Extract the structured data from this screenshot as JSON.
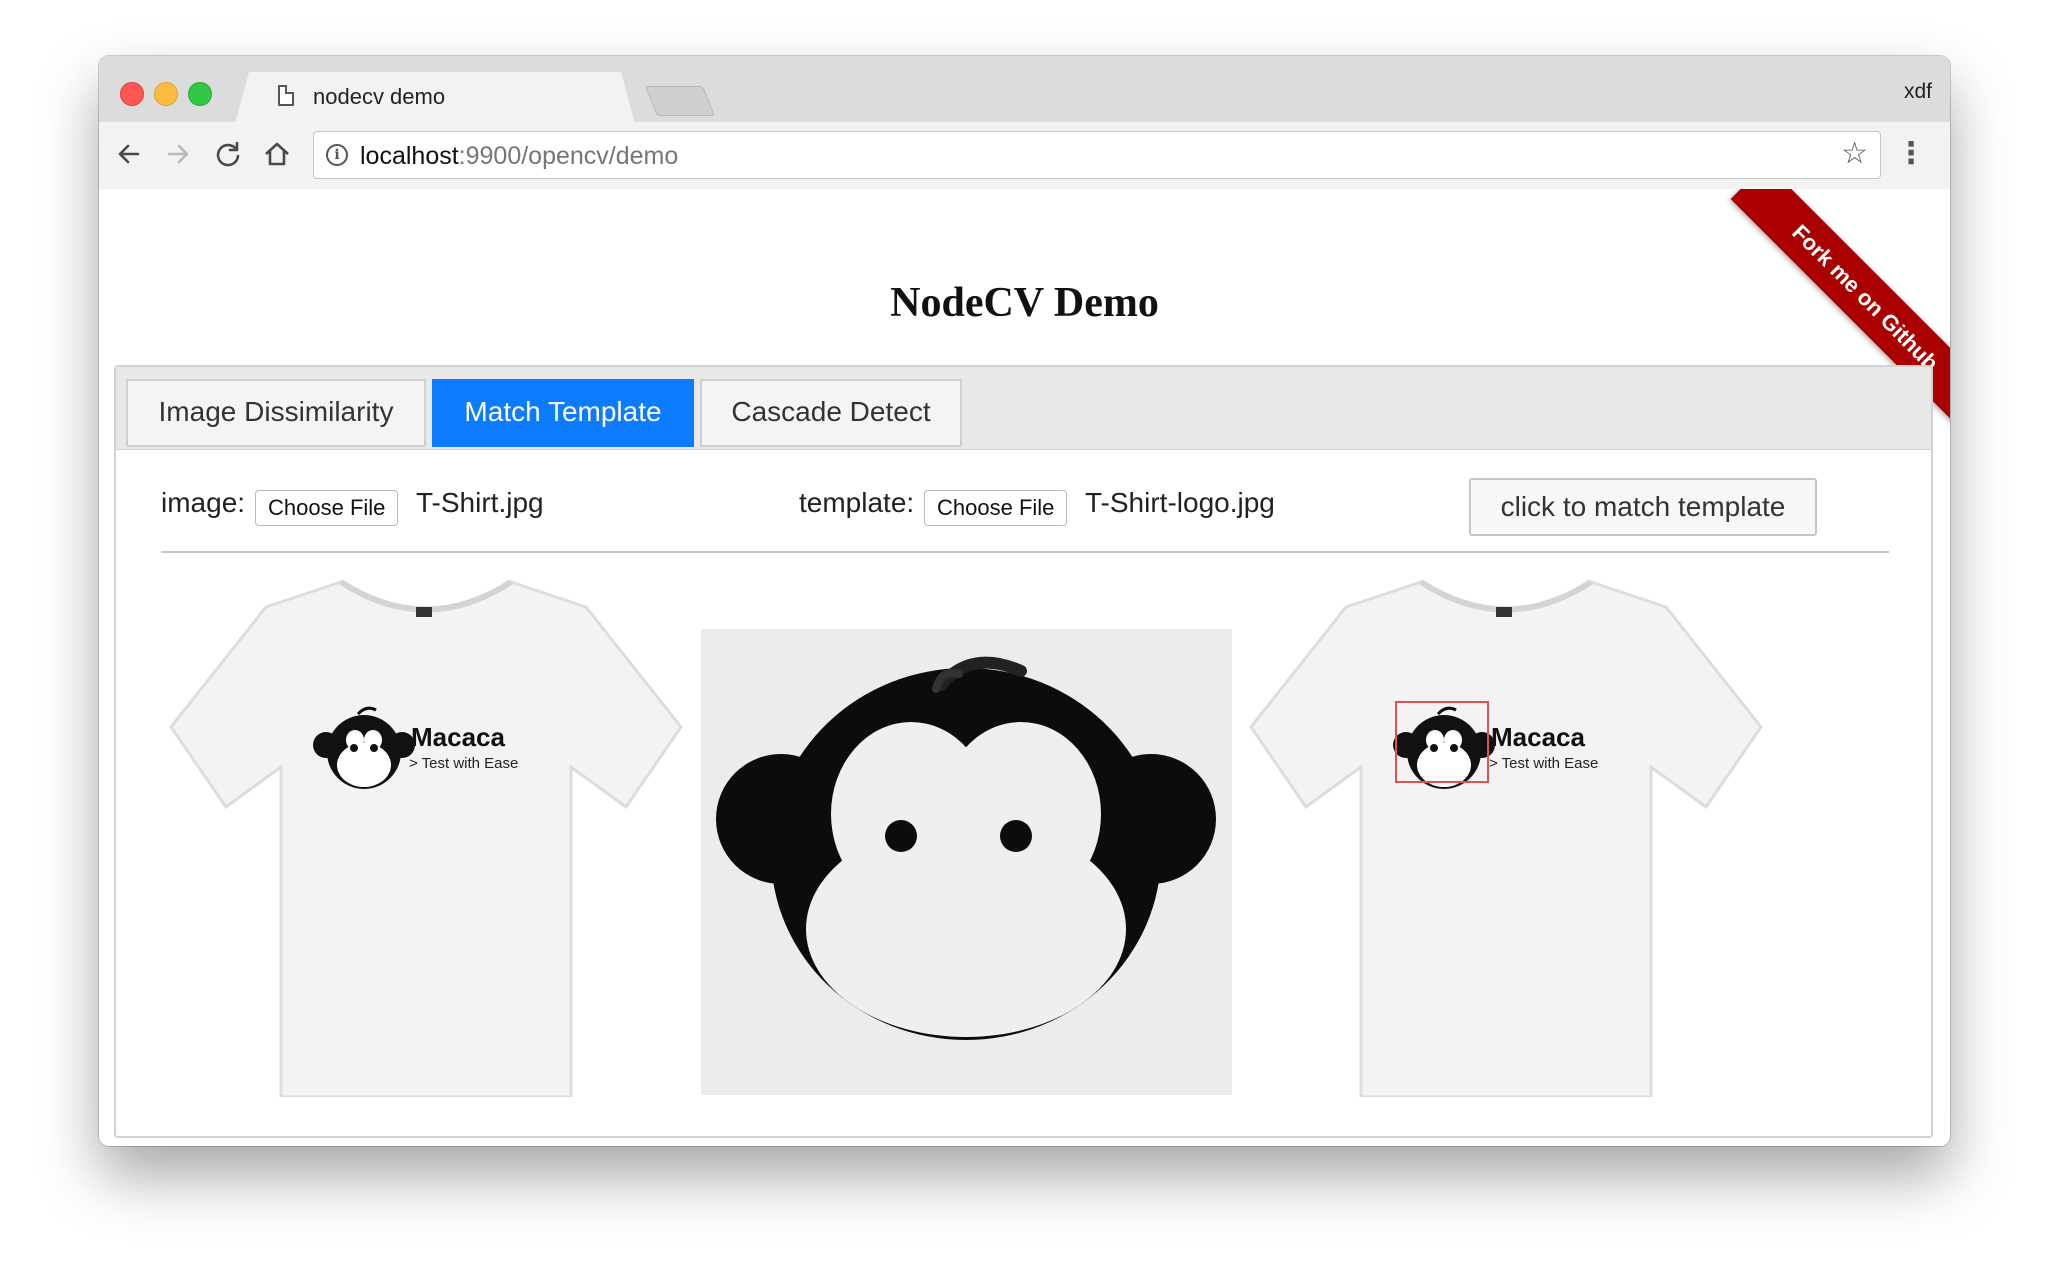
{
  "browser": {
    "tab_title": "nodecv demo",
    "tab_close": "×",
    "profile_name": "xdf",
    "url_host": "localhost",
    "url_rest": ":9900/opencv/demo"
  },
  "icons": {
    "back": "arrow-left",
    "forward": "arrow-right",
    "reload": "reload",
    "home": "home",
    "info": "info",
    "star": "star",
    "menu": "vertical-ellipsis"
  },
  "page": {
    "title": "NodeCV Demo",
    "ribbon": "Fork me on Github"
  },
  "tabs": [
    {
      "label": "Image Dissimilarity",
      "active": false
    },
    {
      "label": "Match Template",
      "active": true
    },
    {
      "label": "Cascade Detect",
      "active": false
    }
  ],
  "form": {
    "image_label": "image:",
    "image_button": "Choose File",
    "image_file": "T-Shirt.jpg",
    "template_label": "template:",
    "template_button": "Choose File",
    "template_file": "T-Shirt-logo.jpg",
    "submit_label": "click to match template"
  },
  "logo": {
    "brand": "Macaca",
    "tagline": "> Test with Ease"
  },
  "colors": {
    "active_tab": "#0d7bff",
    "ribbon": "#aa0000",
    "match_box": "#e05050"
  }
}
